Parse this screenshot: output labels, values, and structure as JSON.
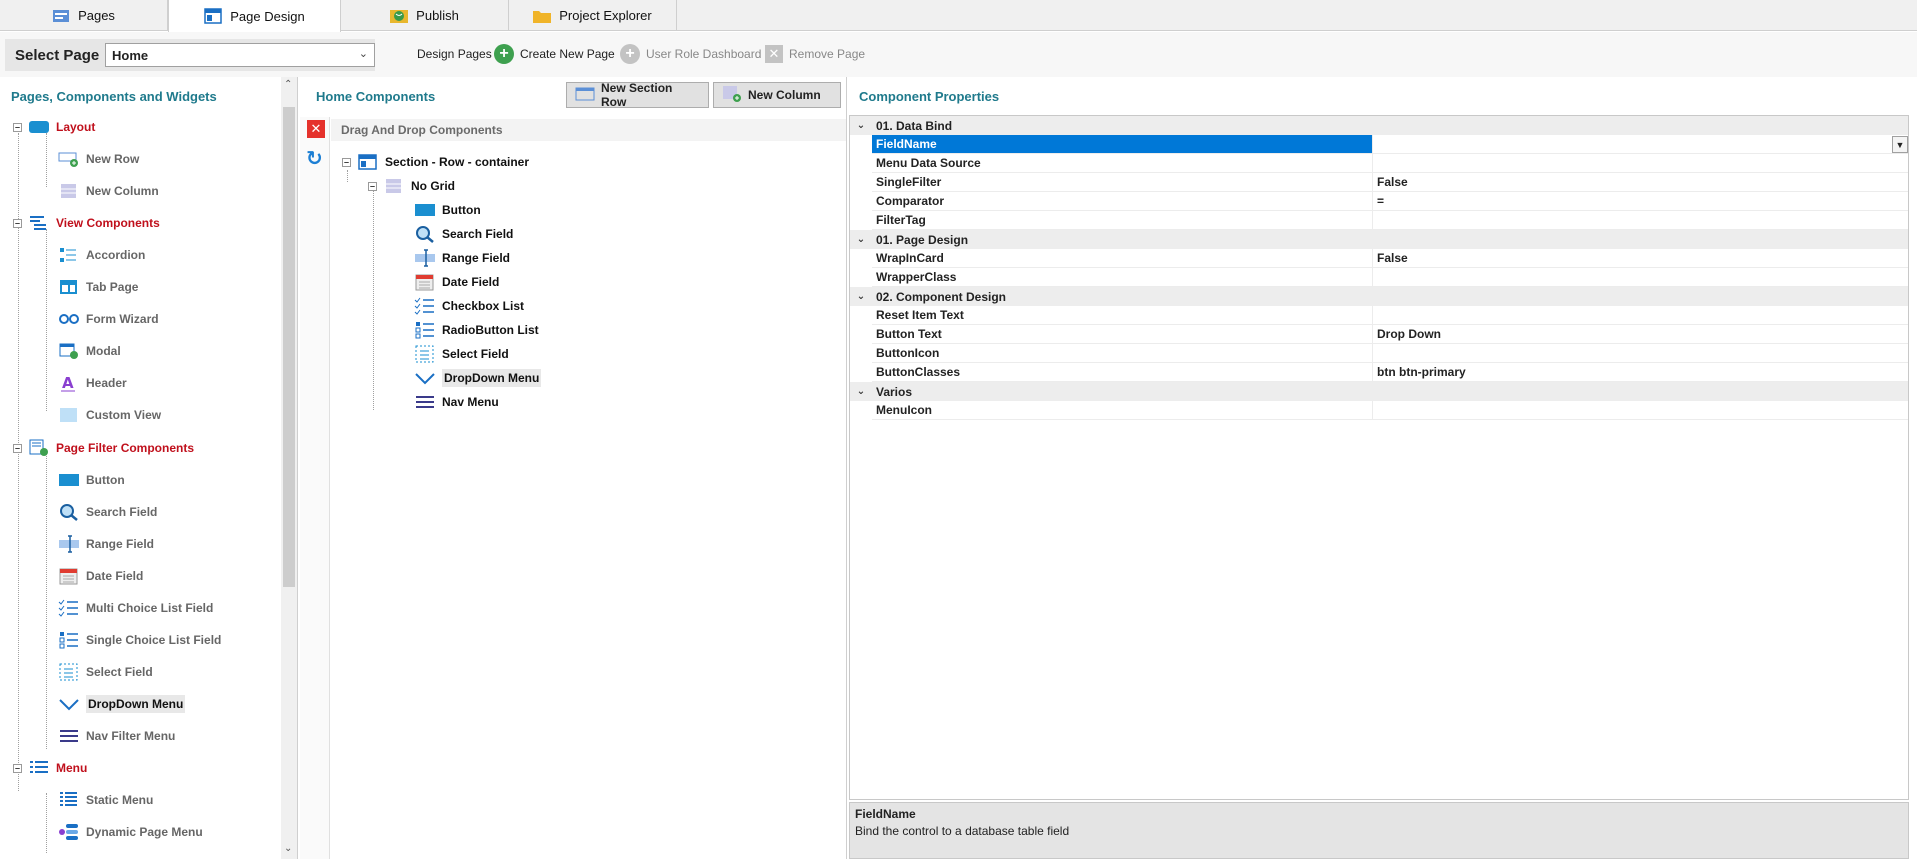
{
  "tabs": [
    {
      "label": "Pages",
      "icon": "pages-icon"
    },
    {
      "label": "Page Design",
      "icon": "page-design-icon"
    },
    {
      "label": "Publish",
      "icon": "globe-icon"
    },
    {
      "label": "Project Explorer",
      "icon": "folder-icon"
    }
  ],
  "toolbar": {
    "select_page_label": "Select Page",
    "select_page_value": "Home",
    "design_pages_label": "Design Pages",
    "create_new_page": "Create New Page",
    "user_role_dashboard": "User Role Dashboard",
    "remove_page": "Remove Page"
  },
  "left": {
    "title": "Pages, Components and Widgets",
    "groups": [
      {
        "label": "Layout",
        "icon": "layout-icon",
        "items": [
          {
            "label": "New Row",
            "icon": "new-row-icon"
          },
          {
            "label": "New Column",
            "icon": "new-column-icon"
          }
        ]
      },
      {
        "label": "View Components",
        "icon": "view-components-icon",
        "items": [
          {
            "label": "Accordion",
            "icon": "accordion-icon"
          },
          {
            "label": "Tab Page",
            "icon": "tab-page-icon"
          },
          {
            "label": "Form Wizard",
            "icon": "form-wizard-icon"
          },
          {
            "label": "Modal",
            "icon": "modal-icon"
          },
          {
            "label": "Header",
            "icon": "header-icon"
          },
          {
            "label": "Custom View",
            "icon": "custom-view-icon"
          }
        ]
      },
      {
        "label": "Page Filter Components",
        "icon": "page-filter-icon",
        "items": [
          {
            "label": "Button",
            "icon": "button-icon"
          },
          {
            "label": "Search Field",
            "icon": "search-icon"
          },
          {
            "label": "Range Field",
            "icon": "range-icon"
          },
          {
            "label": "Date Field",
            "icon": "calendar-icon"
          },
          {
            "label": "Multi Choice List Field",
            "icon": "checklist-icon"
          },
          {
            "label": "Single Choice List Field",
            "icon": "radio-list-icon"
          },
          {
            "label": "Select Field",
            "icon": "select-icon"
          },
          {
            "label": "DropDown Menu",
            "icon": "chevron-down-icon"
          },
          {
            "label": "Nav Filter Menu",
            "icon": "hamburger-icon"
          }
        ]
      },
      {
        "label": "Menu",
        "icon": "menu-icon",
        "items": [
          {
            "label": "Static Menu",
            "icon": "static-menu-icon"
          },
          {
            "label": "Dynamic Page Menu",
            "icon": "dynamic-menu-icon"
          }
        ]
      }
    ]
  },
  "middle": {
    "title": "Home Components",
    "new_section_row": "New Section Row",
    "new_column": "New Column",
    "dnd_header": "Drag And Drop Components",
    "section": "Section - Row - container",
    "grid": "No Grid",
    "components": [
      {
        "label": "Button",
        "icon": "button-icon"
      },
      {
        "label": "Search Field",
        "icon": "search-icon"
      },
      {
        "label": "Range Field",
        "icon": "range-icon"
      },
      {
        "label": "Date Field",
        "icon": "calendar-icon"
      },
      {
        "label": "Checkbox List",
        "icon": "checklist-icon"
      },
      {
        "label": "RadioButton List",
        "icon": "radio-list-icon"
      },
      {
        "label": "Select Field",
        "icon": "select-icon"
      },
      {
        "label": "DropDown Menu",
        "icon": "chevron-down-icon"
      },
      {
        "label": "Nav Menu",
        "icon": "hamburger-icon"
      }
    ]
  },
  "right": {
    "title": "Component Properties",
    "rows": [
      {
        "type": "cat",
        "label": "01. Data Bind"
      },
      {
        "type": "prop",
        "name": "FieldName",
        "value": "",
        "selected": true
      },
      {
        "type": "prop",
        "name": "Menu Data Source",
        "value": ""
      },
      {
        "type": "prop",
        "name": "SingleFilter",
        "value": "False"
      },
      {
        "type": "prop",
        "name": "Comparator",
        "value": "="
      },
      {
        "type": "prop",
        "name": "FilterTag",
        "value": ""
      },
      {
        "type": "cat",
        "label": "01. Page Design"
      },
      {
        "type": "prop",
        "name": "WrapInCard",
        "value": "False"
      },
      {
        "type": "prop",
        "name": "WrapperClass",
        "value": ""
      },
      {
        "type": "cat",
        "label": "02. Component Design"
      },
      {
        "type": "prop",
        "name": "Reset Item Text",
        "value": ""
      },
      {
        "type": "prop",
        "name": "Button Text",
        "value": "Drop Down"
      },
      {
        "type": "prop",
        "name": "ButtonIcon",
        "value": ""
      },
      {
        "type": "prop",
        "name": "ButtonClasses",
        "value": "btn btn-primary"
      },
      {
        "type": "cat",
        "label": "Varios"
      },
      {
        "type": "prop",
        "name": "MenuIcon",
        "value": ""
      }
    ],
    "desc_title": "FieldName",
    "desc_text": "Bind the control to a database table field"
  },
  "colors": {
    "title_teal": "#1f7a8c",
    "group_red": "#c0101c",
    "selection_blue": "#0078d7",
    "icon_blue": "#1a8fd0"
  }
}
